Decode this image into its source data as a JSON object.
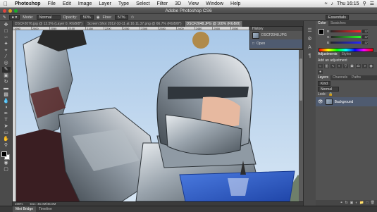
{
  "menubar": {
    "apple": "",
    "app_name": "Photoshop",
    "items": [
      "File",
      "Edit",
      "Image",
      "Layer",
      "Type",
      "Select",
      "Filter",
      "3D",
      "View",
      "Window",
      "Help"
    ],
    "clock": "Thu 16:15"
  },
  "window": {
    "title": "Adobe Photoshop CS6"
  },
  "options": {
    "mode_label": "Mode:",
    "mode_value": "Normal",
    "opacity_label": "Opacity:",
    "opacity_value": "50%",
    "flow_label": "Flow:",
    "flow_value": "57%",
    "workspace": "Essentials"
  },
  "tabs": [
    {
      "label": "DSCF2076.jpg @ 12.5% (Layer 0, RGB/8*)"
    },
    {
      "label": "Screen Shot 2012-10-11 at 16.11.37.png @ 66.7% (RGB/8*)"
    },
    {
      "label": "DSCF2048.JPG @ 100% (RGB/8)"
    }
  ],
  "ruler_ticks": [
    "1950",
    "2000",
    "2050",
    "2100",
    "2150",
    "2200",
    "2250",
    "2300",
    "2350",
    "2400",
    "2450",
    "2500",
    "2550",
    "2600",
    "2650",
    "2700"
  ],
  "history": {
    "title": "History",
    "snapshot": "DSCF2048.JPG",
    "state": "Open"
  },
  "color_panel": {
    "tabs": [
      "Color",
      "Swatches"
    ],
    "channels": [
      {
        "label": "R",
        "value": "37"
      },
      {
        "label": "G",
        "value": "37"
      },
      {
        "label": "B",
        "value": "37"
      }
    ]
  },
  "adjustments": {
    "tabs": [
      "Adjustments",
      "Styles"
    ],
    "hint": "Add an adjustment"
  },
  "layers": {
    "tabs": [
      "Layers",
      "Channels",
      "Paths"
    ],
    "kind": "Kind",
    "blend": "Normal",
    "lock_label": "Lock:",
    "layer_name": "Background"
  },
  "status": {
    "zoom": "100%",
    "doc": "Doc: 45.0M/45.0M"
  },
  "bottom_tabs": [
    "Mini Bridge",
    "Timeline"
  ],
  "colors": {
    "accent": "#4f5b70",
    "sky": "#b7d3ee",
    "armor": "#9aa4ad",
    "shield": "#3662c8"
  }
}
